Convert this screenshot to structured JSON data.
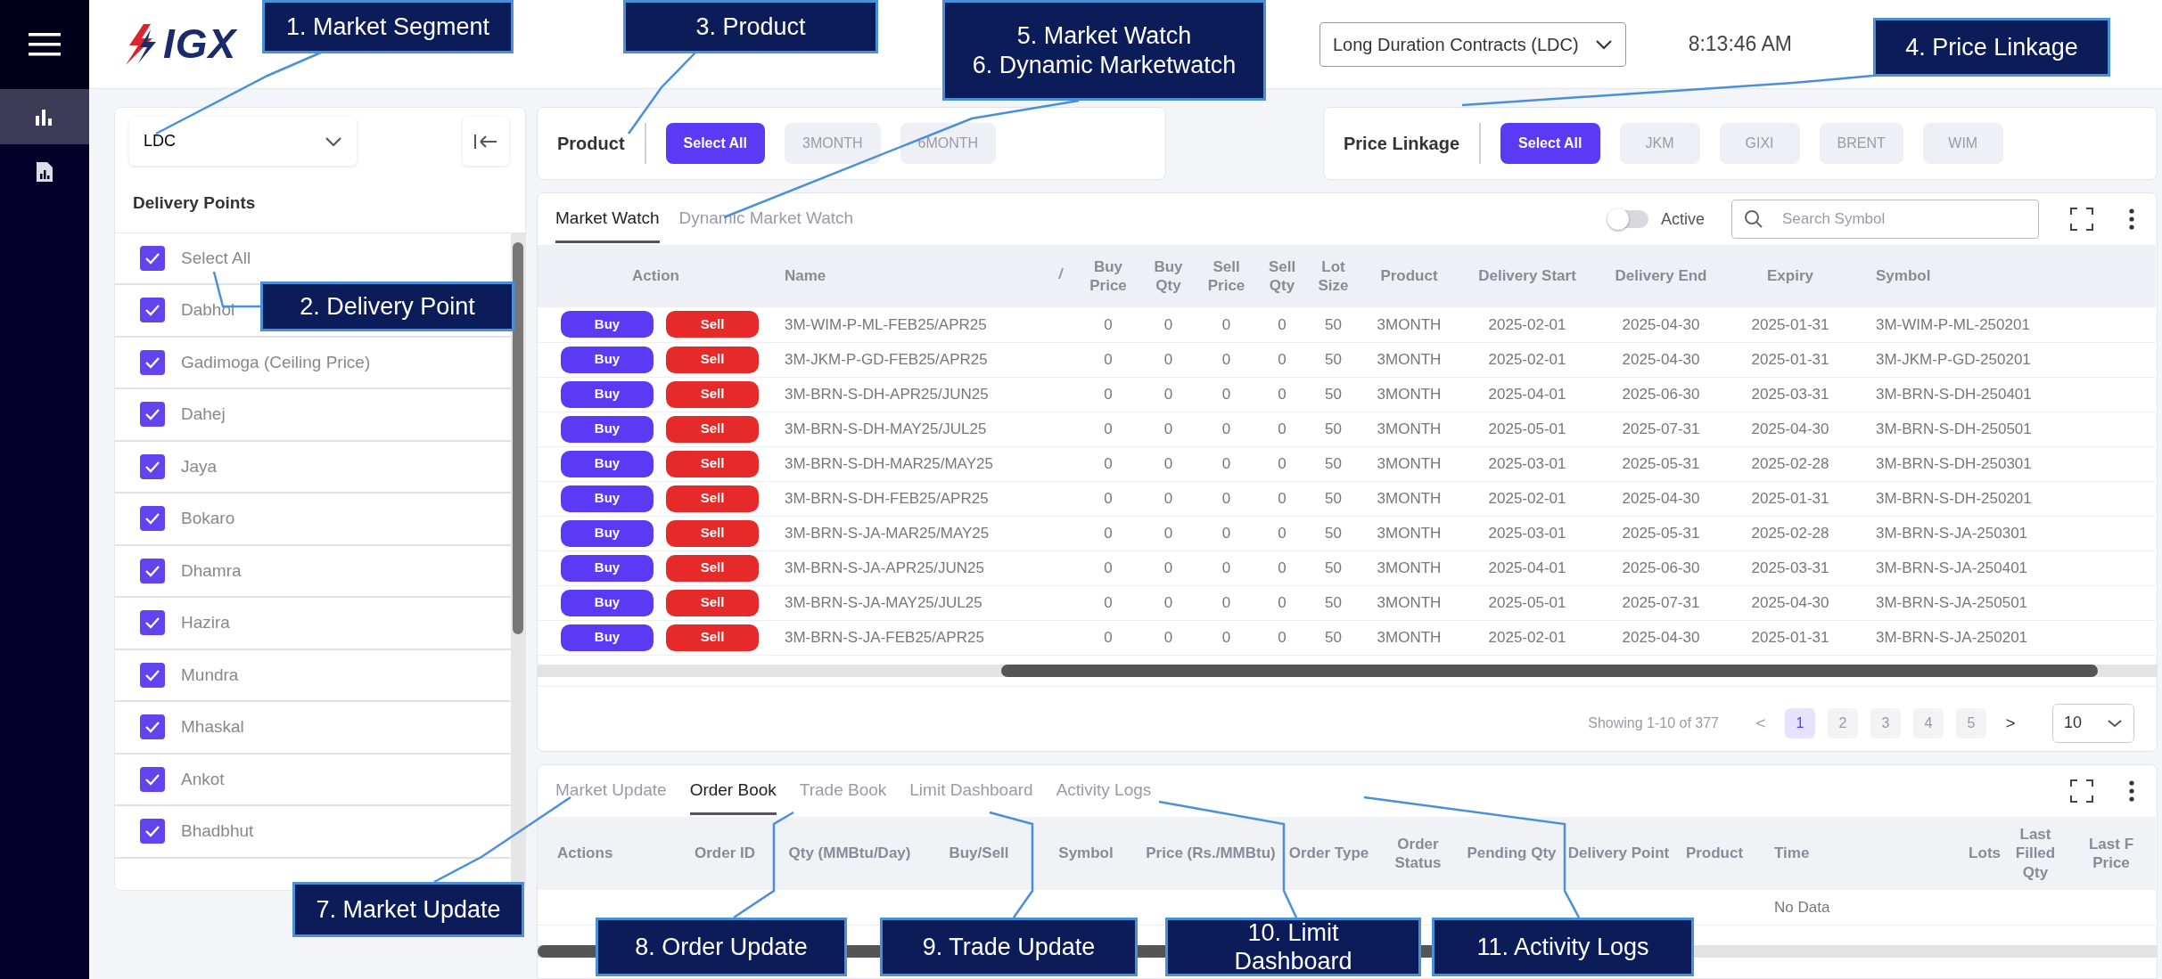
{
  "sidebar": {
    "items": [
      {
        "kind": "chart",
        "selected": true
      },
      {
        "kind": "report",
        "selected": false
      }
    ]
  },
  "header": {
    "logo": "IGX",
    "segment_select": "Long Duration Contracts (LDC)",
    "time": "8:13:46 AM"
  },
  "delivery_panel": {
    "segment": "LDC",
    "title": "Delivery Points",
    "points": [
      {
        "label": "Select All",
        "checked": true
      },
      {
        "label": "Dabhol",
        "checked": true
      },
      {
        "label": "Gadimoga (Ceiling Price)",
        "checked": true
      },
      {
        "label": "Dahej",
        "checked": true
      },
      {
        "label": "Jaya",
        "checked": true
      },
      {
        "label": "Bokaro",
        "checked": true
      },
      {
        "label": "Dhamra",
        "checked": true
      },
      {
        "label": "Hazira",
        "checked": true
      },
      {
        "label": "Mundra",
        "checked": true
      },
      {
        "label": "Mhaskal",
        "checked": true
      },
      {
        "label": "Ankot",
        "checked": true
      },
      {
        "label": "Bhadbhut",
        "checked": true
      }
    ]
  },
  "product_filter": {
    "label": "Product",
    "options": [
      {
        "label": "Select All",
        "selected": true
      },
      {
        "label": "3MONTH",
        "selected": false
      },
      {
        "label": "6MONTH",
        "selected": false
      }
    ]
  },
  "price_linkage": {
    "label": "Price Linkage",
    "options": [
      {
        "label": "Select All",
        "selected": true
      },
      {
        "label": "JKM",
        "selected": false
      },
      {
        "label": "GIXI",
        "selected": false
      },
      {
        "label": "BRENT",
        "selected": false
      },
      {
        "label": "WIM",
        "selected": false
      }
    ]
  },
  "market_watch": {
    "tabs": [
      {
        "label": "Market Watch",
        "selected": true
      },
      {
        "label": "Dynamic Market Watch",
        "selected": false
      }
    ],
    "active_toggle": {
      "label": "Active",
      "on": false
    },
    "search": {
      "placeholder": "Search Symbol"
    },
    "action_column": "Action",
    "columns": [
      "Name",
      "Buy Price",
      "Buy Qty",
      "Sell Price",
      "Sell Qty",
      "Lot Size",
      "Product",
      "Delivery Start",
      "Delivery End",
      "Expiry",
      "Symbol"
    ],
    "rows": [
      {
        "buy": "Buy",
        "sell": "Sell",
        "cells": [
          "3M-WIM-P-ML-FEB25/APR25",
          "0",
          "0",
          "0",
          "0",
          "50",
          "3MONTH",
          "2025-02-01",
          "2025-04-30",
          "2025-01-31",
          "3M-WIM-P-ML-250201"
        ]
      },
      {
        "buy": "Buy",
        "sell": "Sell",
        "cells": [
          "3M-JKM-P-GD-FEB25/APR25",
          "0",
          "0",
          "0",
          "0",
          "50",
          "3MONTH",
          "2025-02-01",
          "2025-04-30",
          "2025-01-31",
          "3M-JKM-P-GD-250201"
        ]
      },
      {
        "buy": "Buy",
        "sell": "Sell",
        "cells": [
          "3M-BRN-S-DH-APR25/JUN25",
          "0",
          "0",
          "0",
          "0",
          "50",
          "3MONTH",
          "2025-04-01",
          "2025-06-30",
          "2025-03-31",
          "3M-BRN-S-DH-250401"
        ]
      },
      {
        "buy": "Buy",
        "sell": "Sell",
        "cells": [
          "3M-BRN-S-DH-MAY25/JUL25",
          "0",
          "0",
          "0",
          "0",
          "50",
          "3MONTH",
          "2025-05-01",
          "2025-07-31",
          "2025-04-30",
          "3M-BRN-S-DH-250501"
        ]
      },
      {
        "buy": "Buy",
        "sell": "Sell",
        "cells": [
          "3M-BRN-S-DH-MAR25/MAY25",
          "0",
          "0",
          "0",
          "0",
          "50",
          "3MONTH",
          "2025-03-01",
          "2025-05-31",
          "2025-02-28",
          "3M-BRN-S-DH-250301"
        ]
      },
      {
        "buy": "Buy",
        "sell": "Sell",
        "cells": [
          "3M-BRN-S-DH-FEB25/APR25",
          "0",
          "0",
          "0",
          "0",
          "50",
          "3MONTH",
          "2025-02-01",
          "2025-04-30",
          "2025-01-31",
          "3M-BRN-S-DH-250201"
        ]
      },
      {
        "buy": "Buy",
        "sell": "Sell",
        "cells": [
          "3M-BRN-S-JA-MAR25/MAY25",
          "0",
          "0",
          "0",
          "0",
          "50",
          "3MONTH",
          "2025-03-01",
          "2025-05-31",
          "2025-02-28",
          "3M-BRN-S-JA-250301"
        ]
      },
      {
        "buy": "Buy",
        "sell": "Sell",
        "cells": [
          "3M-BRN-S-JA-APR25/JUN25",
          "0",
          "0",
          "0",
          "0",
          "50",
          "3MONTH",
          "2025-04-01",
          "2025-06-30",
          "2025-03-31",
          "3M-BRN-S-JA-250401"
        ]
      },
      {
        "buy": "Buy",
        "sell": "Sell",
        "cells": [
          "3M-BRN-S-JA-MAY25/JUL25",
          "0",
          "0",
          "0",
          "0",
          "50",
          "3MONTH",
          "2025-05-01",
          "2025-07-31",
          "2025-04-30",
          "3M-BRN-S-JA-250501"
        ]
      },
      {
        "buy": "Buy",
        "sell": "Sell",
        "cells": [
          "3M-BRN-S-JA-FEB25/APR25",
          "0",
          "0",
          "0",
          "0",
          "50",
          "3MONTH",
          "2025-02-01",
          "2025-04-30",
          "2025-01-31",
          "3M-BRN-S-JA-250201"
        ]
      }
    ],
    "pagination": {
      "summary": "Showing 1-10 of 377",
      "prev": "<",
      "next": ">",
      "pages": [
        {
          "label": "1",
          "selected": true
        },
        {
          "label": "2",
          "selected": false
        },
        {
          "label": "3",
          "selected": false
        },
        {
          "label": "4",
          "selected": false
        },
        {
          "label": "5",
          "selected": false
        }
      ],
      "page_size": "10"
    }
  },
  "order_panel": {
    "tabs": [
      {
        "label": "Market Update",
        "selected": false
      },
      {
        "label": "Order Book",
        "selected": true
      },
      {
        "label": "Trade Book",
        "selected": false
      },
      {
        "label": "Limit Dashboard",
        "selected": false
      },
      {
        "label": "Activity Logs",
        "selected": false
      }
    ],
    "columns": [
      "Actions",
      "Order ID",
      "Qty (MMBtu/Day)",
      "Buy/Sell",
      "Symbol",
      "Price (Rs./MMBtu)",
      "Order Type",
      "Order Status",
      "Pending Qty",
      "Delivery Point",
      "Product",
      "Time",
      "Lots",
      "Last Filled Qty",
      "Last F Price"
    ],
    "empty_text": "No Data"
  },
  "annotations": [
    {
      "lines": [
        "1. Market Segment"
      ]
    },
    {
      "lines": [
        "2. Delivery Point"
      ]
    },
    {
      "lines": [
        "3. Product"
      ]
    },
    {
      "lines": [
        "5. Market Watch",
        "6. Dynamic Marketwatch"
      ]
    },
    {
      "lines": [
        "4. Price Linkage"
      ]
    },
    {
      "lines": [
        "7. Market Update"
      ]
    },
    {
      "lines": [
        "8. Order Update"
      ]
    },
    {
      "lines": [
        "9. Trade Update"
      ]
    },
    {
      "lines": [
        "10. Limit",
        "Dashboard"
      ]
    },
    {
      "lines": [
        "11. Activity Logs"
      ]
    }
  ]
}
